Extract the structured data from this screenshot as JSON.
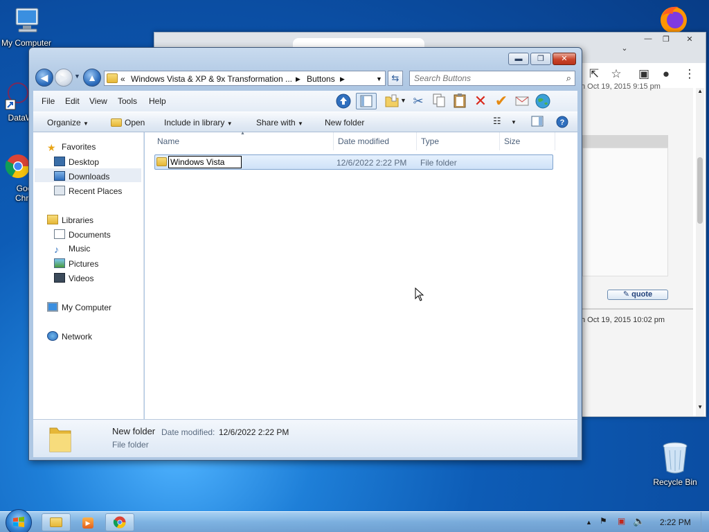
{
  "desktop": {
    "icons": [
      {
        "label": "My Computer",
        "icon": "computer-icon"
      },
      {
        "label": "DataWa",
        "icon": "shortcut-icon"
      },
      {
        "label": "Goo\nChro",
        "icon": "chrome-icon"
      },
      {
        "label": "Recycle Bin",
        "icon": "recycle-bin-icon"
      }
    ]
  },
  "browser": {
    "dates": [
      "n Oct 19, 2015 9:15 pm",
      "n Oct 19, 2015 10:02 pm"
    ],
    "quote_label": "quote"
  },
  "explorer": {
    "window_buttons": {
      "minimize": "▬",
      "maximize": "❐",
      "close": "✕"
    },
    "breadcrumb": {
      "overflow": "«",
      "path": [
        "Windows Vista & XP & 9x Transformation ...",
        "Buttons"
      ]
    },
    "search_placeholder": "Search Buttons",
    "menu": [
      "File",
      "Edit",
      "View",
      "Tools",
      "Help"
    ],
    "commands": {
      "organize": "Organize",
      "open": "Open",
      "include_in_library": "Include in library",
      "share_with": "Share with",
      "new_folder": "New folder"
    },
    "nav": {
      "favorites": "Favorites",
      "desktop": "Desktop",
      "downloads": "Downloads",
      "recent_places": "Recent Places",
      "libraries": "Libraries",
      "documents": "Documents",
      "music": "Music",
      "pictures": "Pictures",
      "videos": "Videos",
      "my_computer": "My Computer",
      "network": "Network"
    },
    "columns": {
      "name": "Name",
      "date_modified": "Date modified",
      "type": "Type",
      "size": "Size"
    },
    "files": [
      {
        "name": "Windows Vista",
        "date_modified": "12/6/2022 2:22 PM",
        "type": "File folder",
        "size": ""
      }
    ],
    "details": {
      "name": "New folder",
      "date_label": "Date modified:",
      "date_value": "12/6/2022 2:22 PM",
      "type": "File folder"
    }
  },
  "taskbar": {
    "time": "2:22 PM",
    "buttons": [
      "explorer-icon",
      "media-player-icon",
      "chrome-icon"
    ]
  },
  "colors": {
    "accent": "#2f6fbe",
    "selection": "#cfe2f8",
    "close": "#c9452b"
  }
}
